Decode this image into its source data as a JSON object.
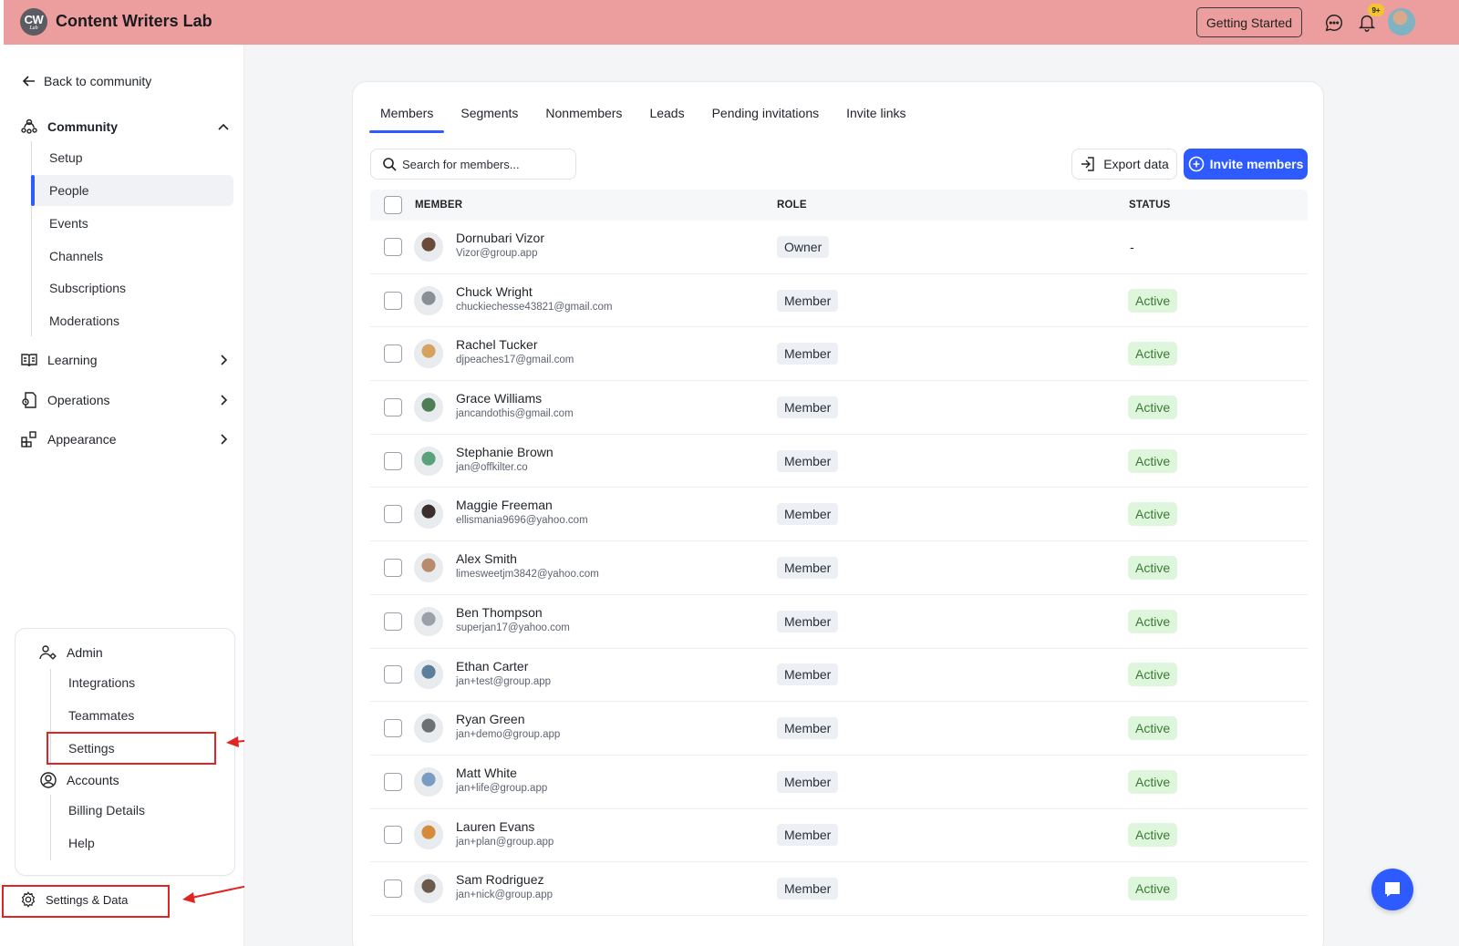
{
  "app": {
    "logo_text": "CW",
    "logo_sub": "Lab",
    "name": "Content Writers Lab",
    "getting_started_label": "Getting Started",
    "notification_badge": "9+",
    "brand_color": "#ec9d9d",
    "accent_color": "#2e5bff"
  },
  "sidebar": {
    "back_label": "Back to community",
    "community": {
      "label": "Community",
      "items": [
        {
          "label": "Setup"
        },
        {
          "label": "People",
          "active": true
        },
        {
          "label": "Events"
        },
        {
          "label": "Channels"
        },
        {
          "label": "Subscriptions"
        },
        {
          "label": "Moderations"
        }
      ]
    },
    "groups": [
      {
        "label": "Learning",
        "icon": "book-icon"
      },
      {
        "label": "Operations",
        "icon": "operations-icon"
      },
      {
        "label": "Appearance",
        "icon": "appearance-icon"
      }
    ],
    "admin": {
      "label": "Admin",
      "items": [
        {
          "label": "Integrations"
        },
        {
          "label": "Teammates"
        },
        {
          "label": "Settings"
        }
      ]
    },
    "accounts": {
      "label": "Accounts",
      "items": [
        {
          "label": "Billing Details"
        },
        {
          "label": "Help"
        }
      ]
    },
    "settings_data_label": "Settings & Data"
  },
  "main": {
    "tabs": [
      {
        "label": "Members",
        "active": true
      },
      {
        "label": "Segments"
      },
      {
        "label": "Nonmembers"
      },
      {
        "label": "Leads"
      },
      {
        "label": "Pending invitations"
      },
      {
        "label": "Invite links"
      }
    ],
    "search_placeholder": "Search for members...",
    "export_label": "Export data",
    "invite_label": "Invite members",
    "columns": [
      "MEMBER",
      "ROLE",
      "STATUS"
    ],
    "members": [
      {
        "name": "Dornubari Vizor",
        "email": "Vizor@group.app",
        "role": "Owner",
        "status": "-"
      },
      {
        "name": "Chuck Wright",
        "email": "chuckiechesse43821@gmail.com",
        "role": "Member",
        "status": "Active"
      },
      {
        "name": "Rachel Tucker",
        "email": "djpeaches17@gmail.com",
        "role": "Member",
        "status": "Active"
      },
      {
        "name": "Grace Williams",
        "email": "jancandothis@gmail.com",
        "role": "Member",
        "status": "Active"
      },
      {
        "name": "Stephanie Brown",
        "email": "jan@offkilter.co",
        "role": "Member",
        "status": "Active"
      },
      {
        "name": "Maggie Freeman",
        "email": "ellismania9696@yahoo.com",
        "role": "Member",
        "status": "Active"
      },
      {
        "name": "Alex Smith",
        "email": "limesweetjm3842@yahoo.com",
        "role": "Member",
        "status": "Active"
      },
      {
        "name": "Ben Thompson",
        "email": "superjan17@yahoo.com",
        "role": "Member",
        "status": "Active"
      },
      {
        "name": "Ethan Carter",
        "email": "jan+test@group.app",
        "role": "Member",
        "status": "Active"
      },
      {
        "name": "Ryan Green",
        "email": "jan+demo@group.app",
        "role": "Member",
        "status": "Active"
      },
      {
        "name": "Matt White",
        "email": "jan+life@group.app",
        "role": "Member",
        "status": "Active"
      },
      {
        "name": "Lauren Evans",
        "email": "jan+plan@group.app",
        "role": "Member",
        "status": "Active"
      },
      {
        "name": "Sam Rodriguez",
        "email": "jan+nick@group.app",
        "role": "Member",
        "status": "Active"
      }
    ]
  }
}
